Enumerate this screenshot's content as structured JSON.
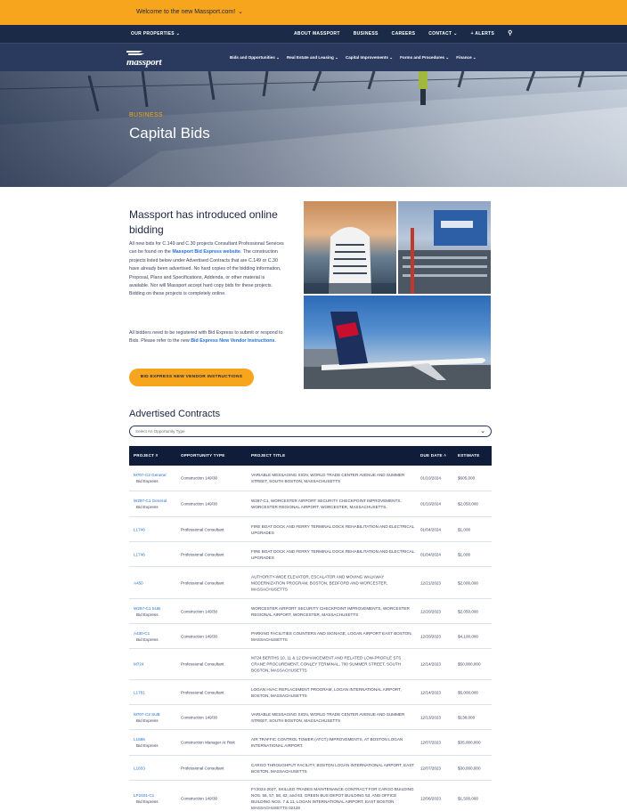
{
  "welcome": {
    "text": "Welcome to the new Massport.com!"
  },
  "utility": {
    "our_properties": "OUR PROPERTIES",
    "links": [
      "ABOUT MASSPORT",
      "BUSINESS",
      "CAREERS",
      "CONTACT",
      "ALERTS"
    ]
  },
  "nav": {
    "logo_text": "massport",
    "items": [
      "Bids and Opportunities",
      "Real Estate and Leasing",
      "Capital Improvements",
      "Forms and Procedures",
      "Finance"
    ]
  },
  "hero": {
    "eyebrow": "BUSINESS",
    "title": "Capital Bids"
  },
  "intro": {
    "title": "Massport has introduced online bidding",
    "p1_a": "All new bids for C.149 and C.30 projects Consultant Professional Services can be found on the ",
    "p1_link": "Massport Bid Express website",
    "p1_b": ". The construction projects listed below under Advertised Contracts that are C.149 or C.30 have already been advertised. No hard copies of the bidding information, Proposal, Plans and Specifications, Addenda, or other material is available. Nor will Massport accept hard copy bids for these projects. Bidding on these projects is completely online.",
    "p2_a": "All bidders need to be registered with Bid Express to submit or respond to Bids. Please refer to the new ",
    "p2_link": "Bid Express New Vendor Instructions",
    "p2_b": ".",
    "button": "BID EXPRESS NEW VENDOR INSTRUCTIONS"
  },
  "contracts": {
    "title": "Advertised Contracts",
    "select_placeholder": "Select An Opportunity Type",
    "headers": [
      "PROJECT #",
      "OPPORTUNITY TYPE",
      "PROJECT TITLE",
      "DUE DATE",
      "ESTIMATE"
    ],
    "rows": [
      {
        "id": "M707-C2 General",
        "sub": "Bid Express",
        "type": "Construction 149/30",
        "title": "VARIABLE MESSAGING SIGN, WORLD TRADE CENTER AVENUE AND SUMMER STREET, SOUTH BOSTON, MASSACHUSETTS",
        "due": "01/10/2024",
        "est": "$605,000"
      },
      {
        "id": "W297-C1 General",
        "sub": "Bid Express",
        "type": "Construction 149/30",
        "title": "W297-C1, WORCESTER AIRPORT SECURITY CHECKPOINT IMPROVEMENTS, WORCESTER REGIONAL AIRPORT, WORCESTER, MASSACHUSETTS.",
        "due": "01/10/2024",
        "est": "$2,050,000"
      },
      {
        "id": "L1746",
        "sub": "",
        "type": "Professional Consultant",
        "title": "FIRE BOAT DOCK AND FERRY TERMINAL DOCK REHABILITATION AND ELECTRICAL UPGRADES",
        "due": "01/04/2024",
        "est": "$1,000"
      },
      {
        "id": "L1746",
        "sub": "",
        "type": "Professional Consultant",
        "title": "FIRE BOAT DOCK AND FERRY TERMINAL DOCK REHABILITATION AND ELECTRICAL UPGRADES",
        "due": "01/04/2024",
        "est": "$1,000"
      },
      {
        "id": "A450",
        "sub": "",
        "type": "Professional Consultant",
        "title": "AUTHORITY-WIDE ELEVATOR, ESCALATOR AND MOVING WALKWAY MODERNIZATION PROGRAM, BOSTON, BEDFORD AND WORCESTER, MASSACHUSETTS",
        "due": "12/21/2023",
        "est": "$2,000,000"
      },
      {
        "id": "W297-C1 SUB",
        "sub": "Bid Express",
        "type": "Construction 149/30",
        "title": "WORCESTER AIRPORT SECURITY CHECKPOINT IMPROVEMENTS, WORCESTER REGIONAL AIRPORT, WORCESTER, MASSACHUSETTS",
        "due": "12/20/2023",
        "est": "$2,050,000"
      },
      {
        "id": "A430-C1",
        "sub": "Bid Express",
        "type": "Construction 149/30",
        "title": "PARKING FACILITIES COUNTERS AND SIGNAGE, LOGAN AIRPORT EAST BOSTON, MASSACHUSETTS",
        "due": "12/20/2023",
        "est": "$4,100,000"
      },
      {
        "id": "M724",
        "sub": "",
        "type": "Professional Consultant",
        "title": "M724 BERTHS 10, 11 & 12 ENHANCEMENT AND RELATED LOW-PROFILE STS CRANE PROCUREMENT, CONLEY TERMINAL, 700 SUMMER STREET, SOUTH BOSTON, MASSACHUSETTS",
        "due": "12/14/2023",
        "est": "$50,000,000"
      },
      {
        "id": "L1781",
        "sub": "",
        "type": "Professional Consultant",
        "title": "LOGAN HVAC REPLACEMENT PROGRAM, LOGAN INTERNATIONAL AIRPORT, BOSTON, MASSACHUSETTS",
        "due": "12/14/2023",
        "est": "$5,000,000"
      },
      {
        "id": "M707-C2 SUB",
        "sub": "Bid Express",
        "type": "Construction 149/30",
        "title": "VARIABLE MESSAGING SIGN, WORLD TRADE CENTER AVENUE AND SUMMER STREET, SOUTH BOSTON, MASSACHUSETTS",
        "due": "12/13/2023",
        "est": "$138,000"
      },
      {
        "id": "L1686",
        "sub": "Bid Express",
        "type": "Construction Manager At Risk",
        "title": "AIR TRAFFIC CONTROL TOWER (ATCT) IMPROVEMENTS, AT BOSTON LOGAN INTERNATIONAL AIRPORT.",
        "due": "12/07/2023",
        "est": "$35,000,000"
      },
      {
        "id": "L1833",
        "sub": "",
        "type": "Professional Consultant",
        "title": "CARGO THROUGHPUT FACILITY, BOSTON LOGAN INTERNATIONAL AIRPORT, EAST BOSTON, MASSACHUSETTS",
        "due": "12/07/2023",
        "est": "$30,000,000"
      },
      {
        "id": "LP2401-C1",
        "sub": "Bid Express",
        "type": "Construction 149/30",
        "title": "FY2024-2027, SKILLED TRADES MAINTENANCE CONTRACT FOR CARGO BUILDING NOS. 56, 57, 58, 62, and 63, GREEN BUS DEPOT BUILDING 53, AND OFFICE BUILDING NOS. 7 & 11, LOGAN INTERNATIONAL AIRPORT, EAST BOSTON MASSACHUSETTS 02128",
        "due": "12/06/2023",
        "est": "$1,500,000"
      }
    ]
  }
}
